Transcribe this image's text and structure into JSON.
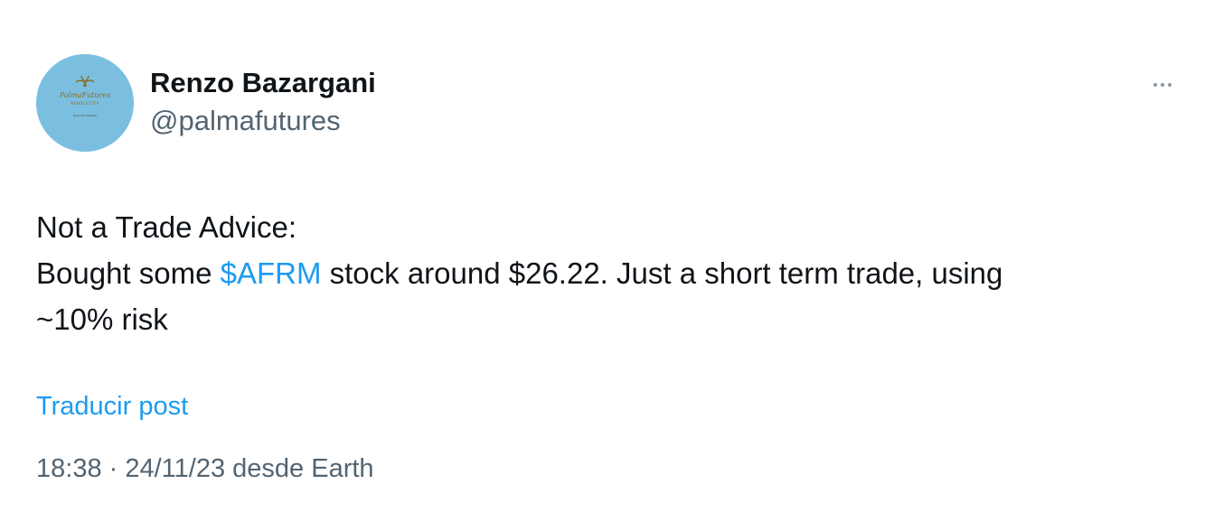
{
  "author": {
    "name": "Renzo Bazargani",
    "handle": "@palmafutures",
    "avatar": {
      "logo_title": "PalmaFutures",
      "logo_subtitle": "NEWSLETTER",
      "logo_tagline": "Financial Markets",
      "background_color": "#7bbfe0"
    }
  },
  "more_button": {
    "icon": "more-horizontal-icon"
  },
  "tweet": {
    "line1": "Not a Trade Advice:",
    "line2_before": "Bought some ",
    "cashtag": "$AFRM",
    "line2_after": " stock around $26.22. Just a short term trade, using",
    "line3": "~10% risk"
  },
  "translate_link": "Traducir post",
  "meta": {
    "time": "18:38",
    "separator": " · ",
    "date": "24/11/23",
    "source": " desde Earth"
  },
  "colors": {
    "link": "#1d9bf0",
    "text": "#0f1419",
    "secondary": "#536471"
  }
}
